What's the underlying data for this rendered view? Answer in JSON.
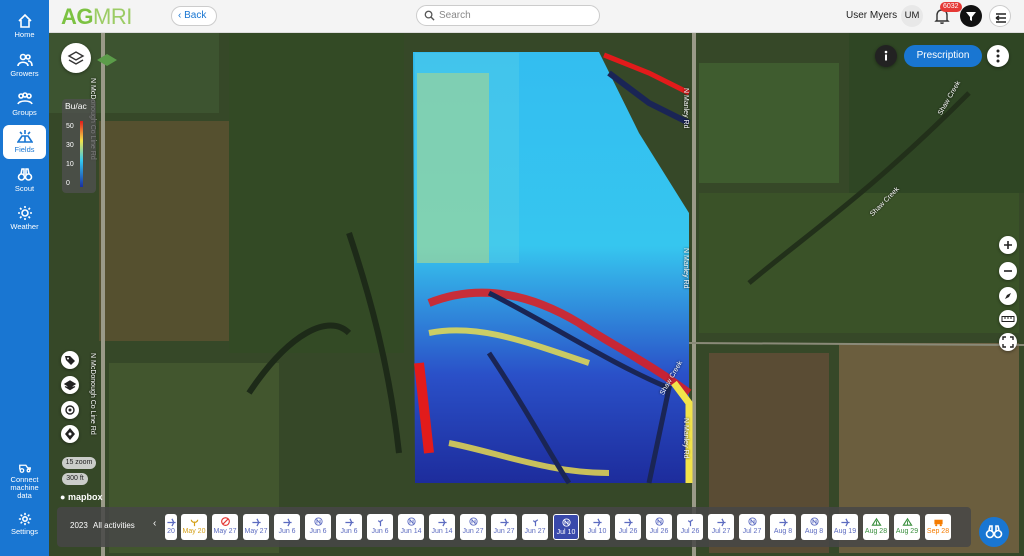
{
  "brand": {
    "ag": "AG",
    "mri": "MRI"
  },
  "topbar": {
    "back_label": "Back",
    "search_placeholder": "Search",
    "user_name": "User Myers",
    "avatar_initials": "UM",
    "notification_count": "6032"
  },
  "sidebar": {
    "items": [
      {
        "label": "Home",
        "icon": "home-icon"
      },
      {
        "label": "Growers",
        "icon": "growers-icon"
      },
      {
        "label": "Groups",
        "icon": "groups-icon"
      },
      {
        "label": "Fields",
        "icon": "fields-icon",
        "active": true
      },
      {
        "label": "Scout",
        "icon": "scout-icon"
      },
      {
        "label": "Weather",
        "icon": "weather-icon"
      }
    ],
    "connect_label": "Connect machine data",
    "settings_label": "Settings"
  },
  "map": {
    "prescription_label": "Prescription",
    "legend": {
      "title": "Bu/ac",
      "values": [
        "50",
        "30",
        "10",
        "0"
      ]
    },
    "road_labels": [
      "N McDonough Co Line Rd",
      "N McDonough Co Line Rd",
      "N Manley Rd",
      "N Manley Rd",
      "N Manley Rd",
      "Shaw Creek",
      "Shaw Creek",
      "Shaw Creek"
    ],
    "zoom_label": "15 zoom",
    "scale_label": "300 ft",
    "attribution": "mapbox"
  },
  "timeline": {
    "year": "2023",
    "filter_label": "All activities",
    "chips": [
      {
        "label": "20",
        "icon": "flight-icon"
      },
      {
        "label": "May 20",
        "icon": "sprout-icon"
      },
      {
        "label": "May 27",
        "icon": "no-icon"
      },
      {
        "label": "May 27",
        "icon": "flight-icon"
      },
      {
        "label": "Jun 6",
        "icon": "flight-icon"
      },
      {
        "label": "Jun 6",
        "icon": "n-icon"
      },
      {
        "label": "Jun 6",
        "icon": "flight-icon"
      },
      {
        "label": "Jun 6",
        "icon": "plant-icon"
      },
      {
        "label": "Jun 14",
        "icon": "n-icon"
      },
      {
        "label": "Jun 14",
        "icon": "flight-icon"
      },
      {
        "label": "Jun 27",
        "icon": "n-icon"
      },
      {
        "label": "Jun 27",
        "icon": "flight-icon"
      },
      {
        "label": "Jun 27",
        "icon": "plant-icon"
      },
      {
        "label": "Jul 10",
        "icon": "n-icon",
        "selected": true
      },
      {
        "label": "Jul 10",
        "icon": "flight-icon"
      },
      {
        "label": "Jul 26",
        "icon": "flight-icon"
      },
      {
        "label": "Jul 26",
        "icon": "n-icon"
      },
      {
        "label": "Jul 26",
        "icon": "plant-icon"
      },
      {
        "label": "Jul 27",
        "icon": "flight-icon"
      },
      {
        "label": "Jul 27",
        "icon": "n-icon"
      },
      {
        "label": "Aug 8",
        "icon": "flight-icon"
      },
      {
        "label": "Aug 8",
        "icon": "n-icon"
      },
      {
        "label": "Aug 19",
        "icon": "flight-icon"
      },
      {
        "label": "Aug 28",
        "icon": "harvest-icon"
      },
      {
        "label": "Aug 29",
        "icon": "harvest-icon"
      },
      {
        "label": "Sep 28",
        "icon": "combine-icon"
      }
    ]
  },
  "colors": {
    "accent": "#1976d2",
    "selected_chip": "#3949ab",
    "yield_high": "#e21b1b",
    "yield_mid": "#f2e34a",
    "yield_low": "#33c9f2",
    "yield_min": "#1a2fa0"
  }
}
